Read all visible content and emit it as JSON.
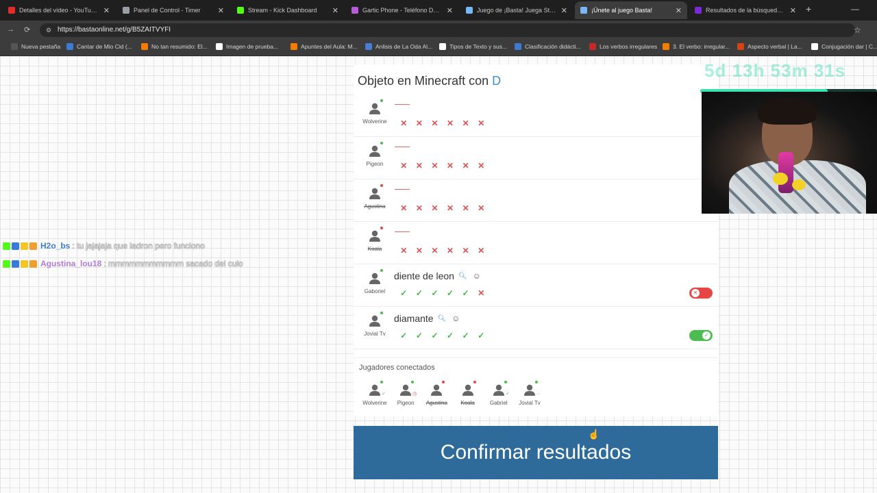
{
  "browser": {
    "tabs": [
      {
        "title": "Detalles del vídeo - YouTube St",
        "color": "#e52d27",
        "active": false
      },
      {
        "title": "Panel de Control - Timer",
        "color": "#9aa0a6",
        "active": false
      },
      {
        "title": "Stream - Kick Dashboard",
        "color": "#53fc18",
        "active": false
      },
      {
        "title": "Gartic Phone - Teléfono Descon",
        "color": "#b55cd8",
        "active": false
      },
      {
        "title": "Juego de ¡Basta! Juega Stop, Tu",
        "color": "#7ab8f5",
        "active": false
      },
      {
        "title": "¡Únete al juego Basta!",
        "color": "#7ab8f5",
        "active": true
      },
      {
        "title": "Resultados de la búsqueda de",
        "color": "#7b2bd6",
        "active": false
      }
    ],
    "new_tab": "+",
    "minimize": "—",
    "url": "https://bastaonline.net/g/B5ZAITVYFI",
    "bookmarks": [
      {
        "label": "Nueva pestaña",
        "color": "#555"
      },
      {
        "label": "Cantar de Mio Cid (...",
        "color": "#3a7bd5"
      },
      {
        "label": "No tan resumido: El...",
        "color": "#f57c00"
      },
      {
        "label": "Imagen de prueba...",
        "color": "#ffffff"
      },
      {
        "label": "Apuntes del Aula: M...",
        "color": "#f57c00"
      },
      {
        "label": "Anlisis de La Oda Al...",
        "color": "#4a7bd5"
      },
      {
        "label": "Tipos de Texto y sus...",
        "color": "#ffffff"
      },
      {
        "label": "Clasificación didácti...",
        "color": "#3a7bd5"
      },
      {
        "label": "Los verbos irregulares",
        "color": "#c62828"
      },
      {
        "label": "3. El verbo: irregular...",
        "color": "#f57c00"
      },
      {
        "label": "Aspecto verbal | La...",
        "color": "#d84315"
      },
      {
        "label": "Conjugación dar | C...",
        "color": "#ffffff"
      }
    ]
  },
  "game": {
    "category_prefix": "Objeto en Minecraft con",
    "letter": "D",
    "rows": [
      {
        "player": "Wolverine",
        "strike": false,
        "status_color": "#4cbb50",
        "answer": "",
        "votes": [
          "x",
          "x",
          "x",
          "x",
          "x",
          "x"
        ],
        "toggle": null
      },
      {
        "player": "Pigeon",
        "strike": false,
        "status_color": "#4cbb50",
        "answer": "",
        "votes": [
          "x",
          "x",
          "x",
          "x",
          "x",
          "x"
        ],
        "toggle": null
      },
      {
        "player": "Agustina",
        "strike": true,
        "status_color": "#e84545",
        "answer": "",
        "votes": [
          "x",
          "x",
          "x",
          "x",
          "x",
          "x"
        ],
        "toggle": null
      },
      {
        "player": "Koala",
        "strike": true,
        "status_color": "#e84545",
        "answer": "",
        "votes": [
          "x",
          "x",
          "x",
          "x",
          "x",
          "x"
        ],
        "toggle": null
      },
      {
        "player": "Gaboriel",
        "strike": false,
        "status_color": "#4cbb50",
        "answer": "diente de leon",
        "votes": [
          "ok",
          "ok",
          "ok",
          "ok",
          "ok",
          "x"
        ],
        "toggle": "off"
      },
      {
        "player": "Jovial Tv",
        "strike": false,
        "status_color": "#4cbb50",
        "answer": "diamante",
        "votes": [
          "ok",
          "ok",
          "ok",
          "ok",
          "ok",
          "ok"
        ],
        "toggle": "on"
      }
    ],
    "connected_title": "Jugadores conectados",
    "connected": [
      {
        "name": "Wolverine",
        "strike": false,
        "status_color": "#4cbb50",
        "status_icon": "✓"
      },
      {
        "name": "Pigeon",
        "strike": false,
        "status_color": "#4cbb50",
        "status_icon": "◷"
      },
      {
        "name": "Agustina",
        "strike": true,
        "status_color": "#e84545",
        "status_icon": ""
      },
      {
        "name": "Koala",
        "strike": true,
        "status_color": "#e84545",
        "status_icon": ""
      },
      {
        "name": "Gabriel",
        "strike": false,
        "status_color": "#4cbb50",
        "status_icon": "✓"
      },
      {
        "name": "Jovial Tv",
        "strike": false,
        "status_color": "#4cbb50",
        "status_icon": "…"
      }
    ],
    "confirm_label": "Confirmar resultados"
  },
  "overlay": {
    "timer": "5d 13h 53m 31s",
    "timer_progress": 0.72,
    "chat": [
      {
        "user": "H2o_bs",
        "user_color": "#3a7bd5",
        "message": ": tu jajajaja que ladron pero funciono"
      },
      {
        "user": "Agustina_lou18",
        "user_color": "#b07ad8",
        "message": ": mmmmmmmmmmm sacado del culo"
      }
    ]
  }
}
